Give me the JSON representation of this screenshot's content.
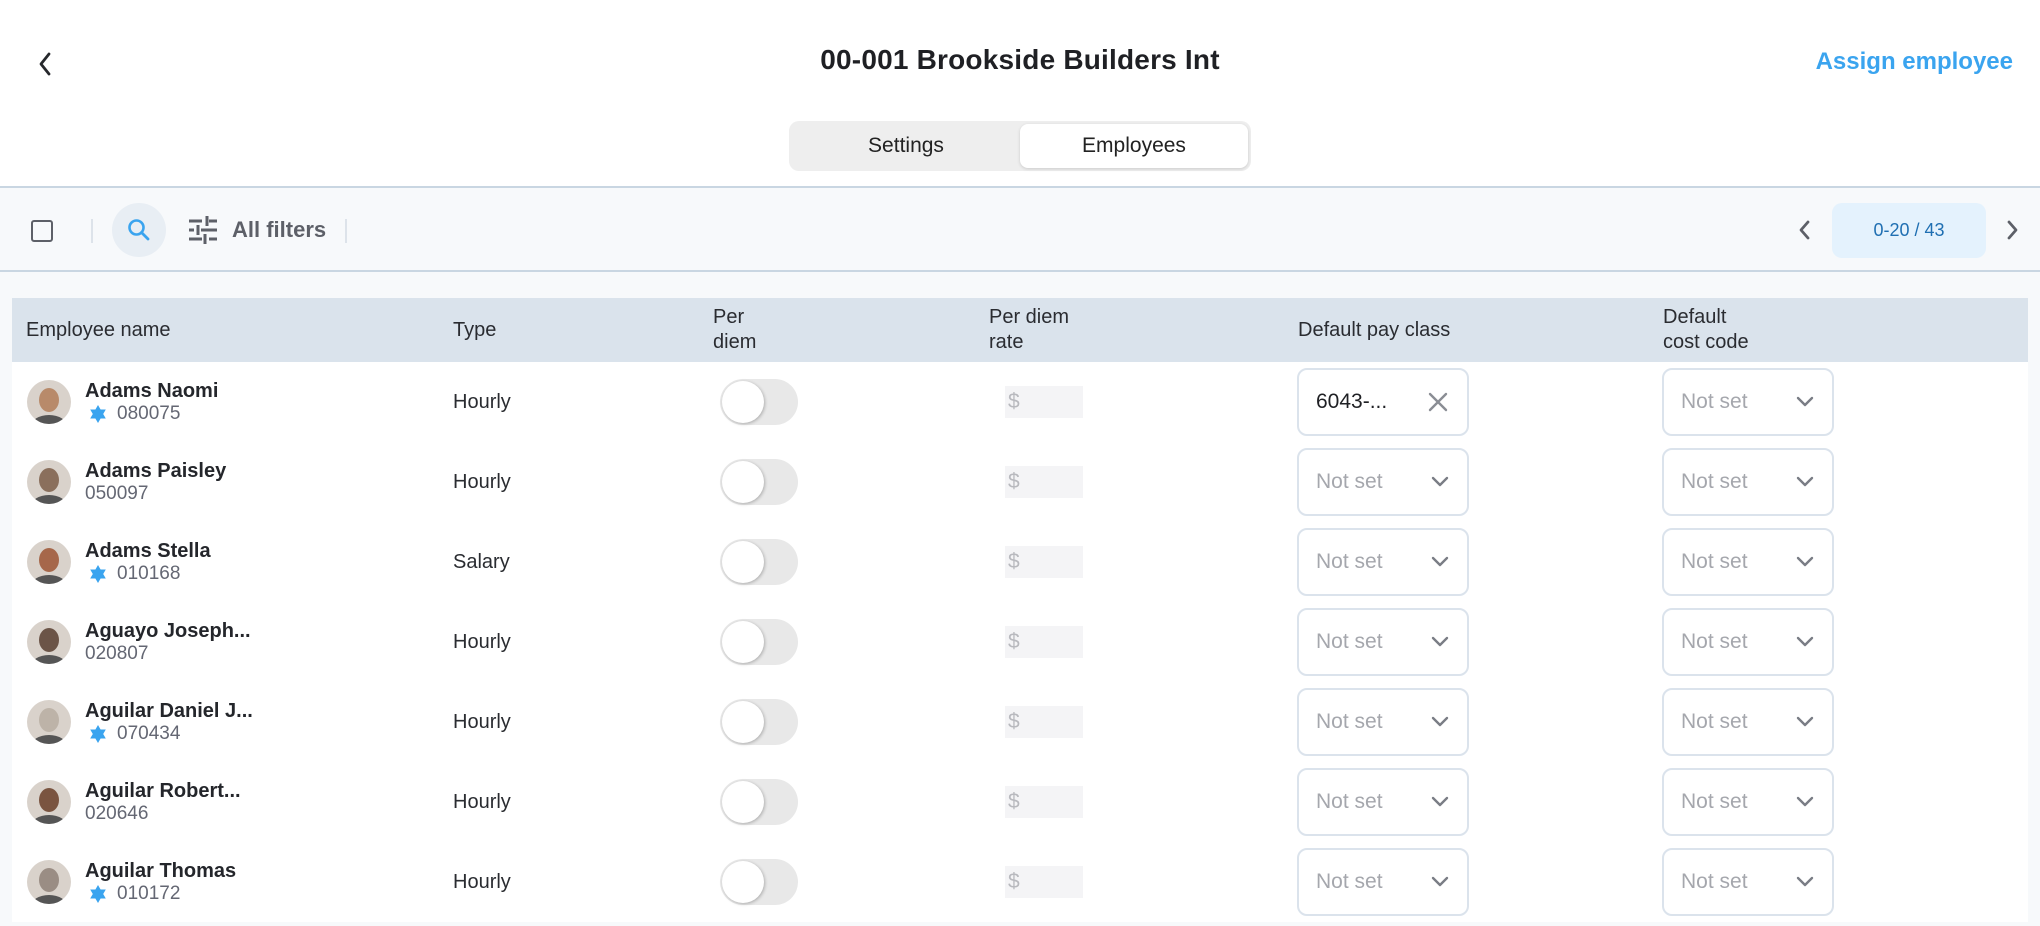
{
  "header": {
    "title": "00-001 Brookside Builders Int",
    "assign_label": "Assign employee",
    "tabs": [
      {
        "label": "Settings",
        "active": false
      },
      {
        "label": "Employees",
        "active": true
      }
    ]
  },
  "toolbar": {
    "filters_label": "All filters",
    "pagination": "0-20 / 43"
  },
  "colors": {
    "accent": "#3aa4ef",
    "header_bg": "#dae3ec",
    "badge": "#3aa4ef"
  },
  "table": {
    "columns": [
      {
        "line1": "Employee name",
        "line2": ""
      },
      {
        "line1": "Type",
        "line2": ""
      },
      {
        "line1": "Per",
        "line2": "diem"
      },
      {
        "line1": "Per diem",
        "line2": "rate"
      },
      {
        "line1": "Default pay class",
        "line2": ""
      },
      {
        "line1": "Default",
        "line2": "cost code"
      }
    ],
    "rows": [
      {
        "name": "Adams Naomi",
        "id": "080075",
        "badge": true,
        "type": "Hourly",
        "per_diem": false,
        "rate_prefix": "$",
        "pay_class": "6043-...",
        "pay_class_set": true,
        "cost_code": "Not set",
        "avatar": "#b88a6a"
      },
      {
        "name": "Adams Paisley",
        "id": "050097",
        "badge": false,
        "type": "Hourly",
        "per_diem": false,
        "rate_prefix": "$",
        "pay_class": "Not set",
        "pay_class_set": false,
        "cost_code": "Not set",
        "avatar": "#8a6f5c"
      },
      {
        "name": "Adams Stella",
        "id": "010168",
        "badge": true,
        "type": "Salary",
        "per_diem": false,
        "rate_prefix": "$",
        "pay_class": "Not set",
        "pay_class_set": false,
        "cost_code": "Not set",
        "avatar": "#a6674a"
      },
      {
        "name": "Aguayo Joseph...",
        "id": "020807",
        "badge": false,
        "type": "Hourly",
        "per_diem": false,
        "rate_prefix": "$",
        "pay_class": "Not set",
        "pay_class_set": false,
        "cost_code": "Not set",
        "avatar": "#6b5447"
      },
      {
        "name": "Aguilar Daniel J...",
        "id": "070434",
        "badge": true,
        "type": "Hourly",
        "per_diem": false,
        "rate_prefix": "$",
        "pay_class": "Not set",
        "pay_class_set": false,
        "cost_code": "Not set",
        "avatar": "#bdb3a8"
      },
      {
        "name": "Aguilar Robert...",
        "id": "020646",
        "badge": false,
        "type": "Hourly",
        "per_diem": false,
        "rate_prefix": "$",
        "pay_class": "Not set",
        "pay_class_set": false,
        "cost_code": "Not set",
        "avatar": "#7a5440"
      },
      {
        "name": "Aguilar Thomas",
        "id": "010172",
        "badge": true,
        "type": "Hourly",
        "per_diem": false,
        "rate_prefix": "$",
        "pay_class": "Not set",
        "pay_class_set": false,
        "cost_code": "Not set",
        "avatar": "#9a8d84"
      }
    ]
  }
}
